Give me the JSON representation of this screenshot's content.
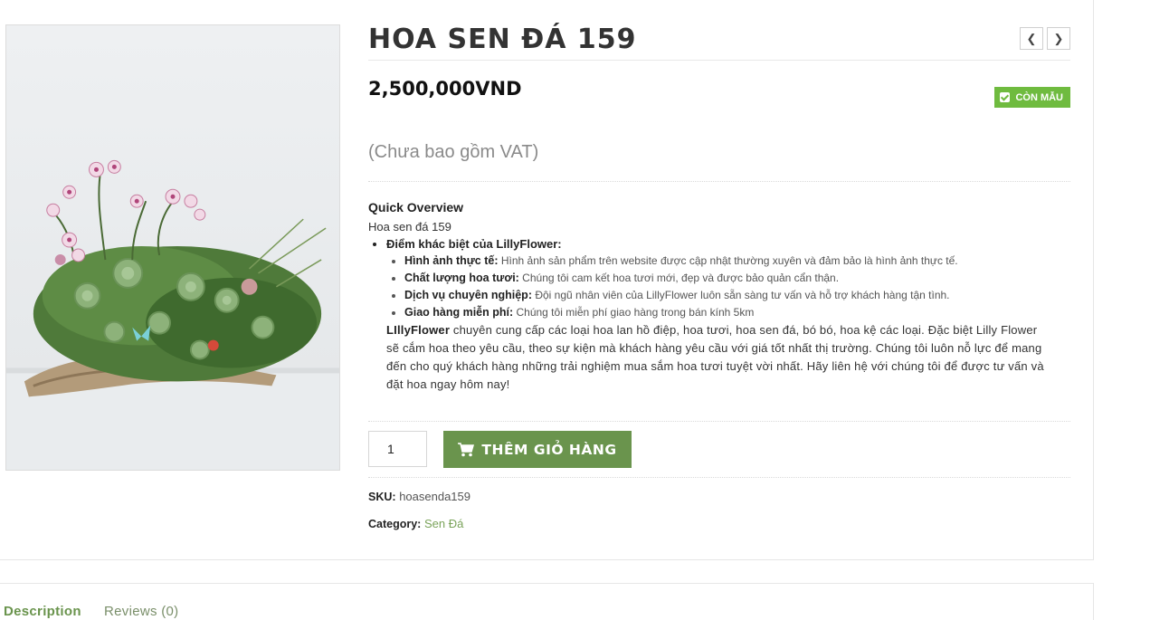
{
  "product": {
    "title": "HOA SEN ĐÁ 159",
    "price": "2,500,000VND",
    "stock_label": "CÒN MẪU",
    "vat_note": "(Chưa bao gồm VAT)",
    "quick_overview": {
      "heading": "Quick Overview",
      "line": "Hoa sen đá 159",
      "bullet_title": "Điểm khác biệt của LillyFlower:",
      "points": [
        {
          "label": "Hình ảnh thực tế:",
          "text": " Hình ảnh sản phẩm trên website được cập nhật thường xuyên và đảm bảo là hình ảnh thực tế."
        },
        {
          "label": "Chất lượng hoa tươi:",
          "text": " Chúng tôi cam kết hoa tươi mới, đẹp và được bảo quản cẩn thận."
        },
        {
          "label": "Dịch vụ chuyên nghiệp:",
          "text": " Đội ngũ nhân viên của LillyFlower luôn sẵn sàng tư vấn và hỗ trợ khách hàng tận tình."
        },
        {
          "label": "Giao hàng miễn phí:",
          "text": " Chúng tôi miễn phí giao hàng trong bán kính 5km"
        }
      ],
      "intro_brand": "LIllyFlower",
      "intro_text": " chuyên cung cấp các loại hoa lan hồ điệp, hoa tươi, hoa sen đá, bó bó, hoa kệ các loại. Đặc biệt Lilly Flower sẽ cắm hoa theo yêu cầu, theo sự kiện mà khách hàng yêu cầu với giá tốt nhất thị trường. Chúng tôi luôn nỗ lực để mang đến cho quý khách hàng những trải nghiệm mua sắm hoa tươi tuyệt vời nhất. Hãy liên hệ với chúng tôi để được tư vấn và đặt hoa ngay hôm nay!"
    },
    "quantity": "1",
    "add_to_cart_label": "THÊM GIỎ HÀNG",
    "sku_label": "SKU:",
    "sku_value": "hoasenda159",
    "category_label": "Category:",
    "category_value": "Sen Đá"
  },
  "tabs": [
    {
      "label": "Description"
    },
    {
      "label": "Reviews (0)"
    }
  ],
  "icons": {
    "prev": "chevron-left-icon",
    "next": "chevron-right-icon",
    "stock": "check-square-icon",
    "cart": "shopping-cart-icon"
  },
  "colors": {
    "accent_green": "#6a944d",
    "stock_green": "#6fbb3f",
    "link_green": "#7aa35a"
  }
}
